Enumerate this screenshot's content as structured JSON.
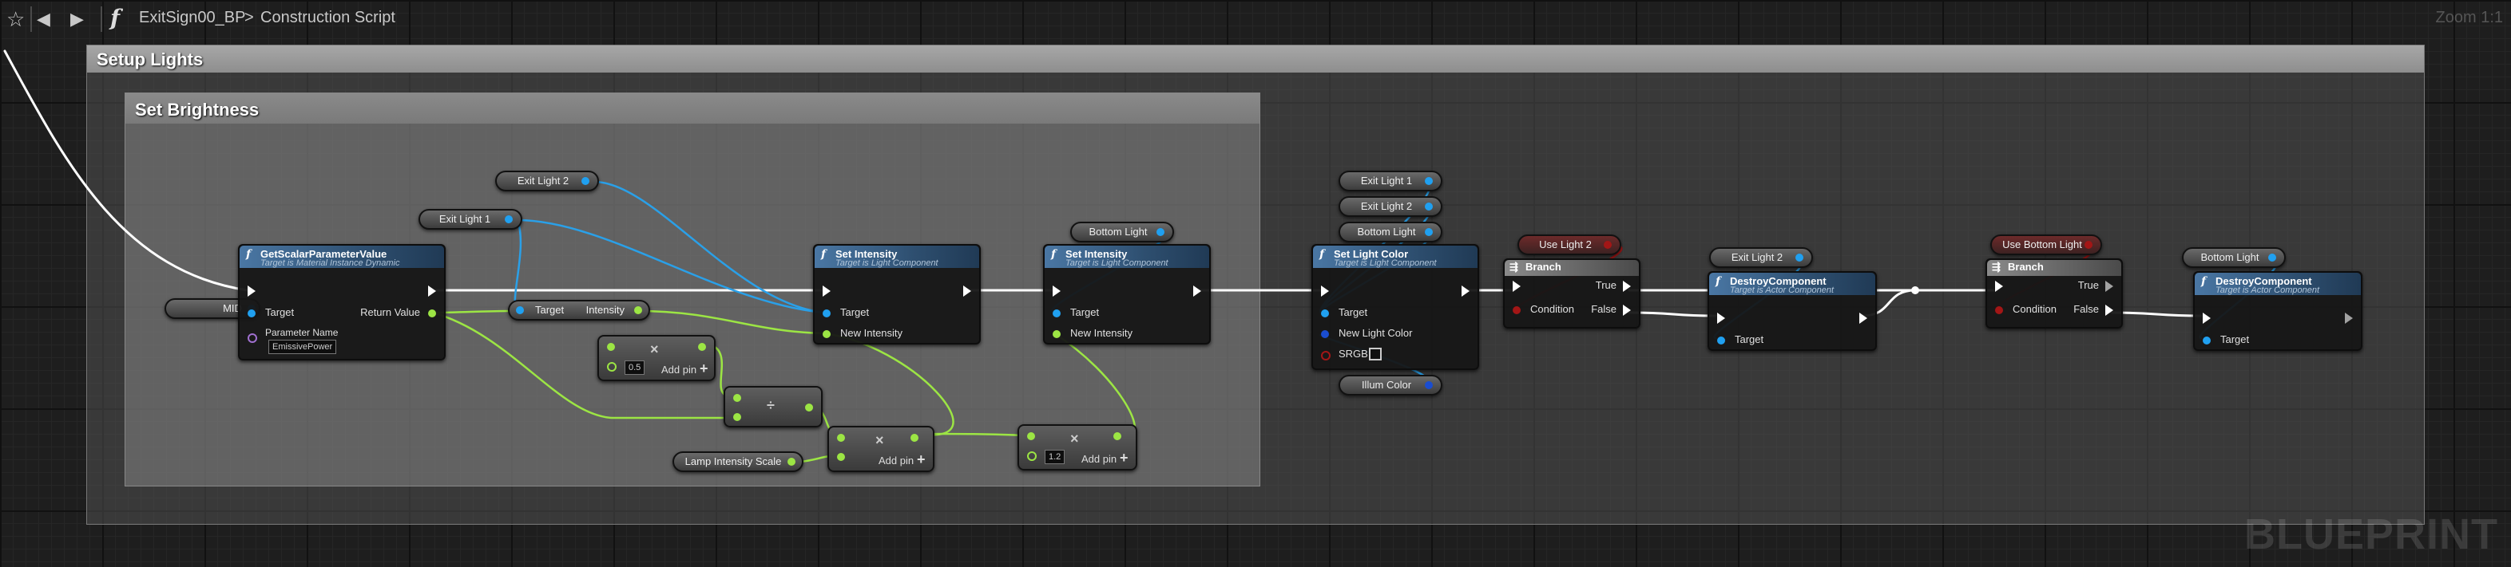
{
  "toolbar": {
    "breadcrumb_blueprint": "ExitSign00_BP",
    "breadcrumb_sep": ">",
    "breadcrumb_graph": "Construction Script",
    "zoom": "Zoom 1:1"
  },
  "comments": {
    "outer_title": "Setup Lights",
    "inner_title": "Set Brightness"
  },
  "variables": {
    "exit_light_2_a": "Exit Light 2",
    "exit_light_1_a": "Exit Light 1",
    "mid": "MID",
    "bottom_light_a": "Bottom Light",
    "exit_light_1_b": "Exit Light 1",
    "exit_light_2_b": "Exit Light 2",
    "bottom_light_b": "Bottom Light",
    "illum_color": "Illum Color",
    "use_light_2": "Use Light 2",
    "exit_light_2_c": "Exit Light 2",
    "use_bottom_light": "Use Bottom Light",
    "bottom_light_c": "Bottom Light",
    "lamp_intensity_scale": "Lamp Intensity Scale"
  },
  "nodes": {
    "get_scalar": {
      "title": "GetScalarParameterValue",
      "subtitle": "Target is Material Instance Dynamic",
      "target": "Target",
      "return_value": "Return Value",
      "param_name": "Parameter Name",
      "param_value": "EmissivePower"
    },
    "break_intensity": {
      "target": "Target",
      "intensity": "Intensity"
    },
    "set_intensity_1": {
      "title": "Set Intensity",
      "subtitle": "Target is Light Component",
      "target": "Target",
      "new_intensity": "New Intensity"
    },
    "set_intensity_2": {
      "title": "Set Intensity",
      "subtitle": "Target is Light Component",
      "target": "Target",
      "new_intensity": "New Intensity"
    },
    "set_light_color": {
      "title": "Set Light Color",
      "subtitle": "Target is Light Component",
      "target": "Target",
      "new_light_color": "New Light Color",
      "srgb": "SRGB"
    },
    "branch_1": {
      "title": "Branch",
      "true": "True",
      "condition": "Condition",
      "false": "False"
    },
    "destroy_1": {
      "title": "DestroyComponent",
      "subtitle": "Target is Actor Component",
      "target": "Target"
    },
    "branch_2": {
      "title": "Branch",
      "true": "True",
      "condition": "Condition",
      "false": "False"
    },
    "destroy_2": {
      "title": "DestroyComponent",
      "subtitle": "Target is Actor Component",
      "target": "Target"
    }
  },
  "math": {
    "multiply_1_value": "0.5",
    "multiply_1_addpin": "Add pin",
    "divide_symbol": "÷",
    "multiply_2_addpin": "Add pin",
    "multiply_3_value": "1.2",
    "multiply_3_addpin": "Add pin",
    "multiply_symbol": "×",
    "plus": "+"
  },
  "watermark": "BLUEPRINT",
  "colors": {
    "exec_wire": "#ffffff",
    "object_wire": "#2aa0e8",
    "float_wire": "#9ce544",
    "bool_wire": "#a31616",
    "node_header": "#4a77a4"
  }
}
